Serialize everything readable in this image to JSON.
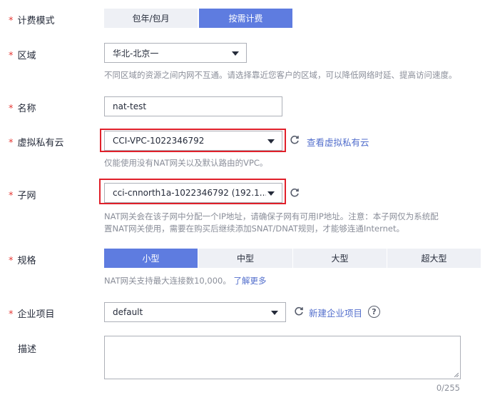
{
  "billing": {
    "label": "计费模式",
    "options": [
      "包年/包月",
      "按需计费"
    ],
    "selected": "按需计费"
  },
  "region": {
    "label": "区域",
    "value": "华北-北京一",
    "hint": "不同区域的资源之间内网不互通。请选择靠近您客户的区域，可以降低网络时延、提高访问速度。"
  },
  "name": {
    "label": "名称",
    "value": "nat-test"
  },
  "vpc": {
    "label": "虚拟私有云",
    "value": "CCI-VPC-1022346792",
    "link": "查看虚拟私有云",
    "hint": "仅能使用没有NAT网关以及默认路由的VPC。"
  },
  "subnet": {
    "label": "子网",
    "value": "cci-cnnorth1a-1022346792 (192.1...",
    "hint_line1": "NAT网关会在该子网中分配一个IP地址，请确保子网有可用IP地址。注意：本子网仅为系统配",
    "hint_line2": "置NAT网关使用，需要在购买后继续添加SNAT/DNAT规则，才能够连通Internet。"
  },
  "spec": {
    "label": "规格",
    "options": [
      "小型",
      "中型",
      "大型",
      "超大型"
    ],
    "selected": "小型",
    "hint": "NAT网关支持最大连接数10,000。",
    "hint_link": "了解更多"
  },
  "enterprise": {
    "label": "企业项目",
    "value": "default",
    "link": "新建企业项目",
    "help_glyph": "?"
  },
  "description": {
    "label": "描述",
    "counter": "0/255"
  },
  "required_mark": "*",
  "colors": {
    "accent": "#5e7ce0",
    "highlight_box": "#e0202a",
    "link": "#526ecc",
    "required": "#e53935"
  }
}
